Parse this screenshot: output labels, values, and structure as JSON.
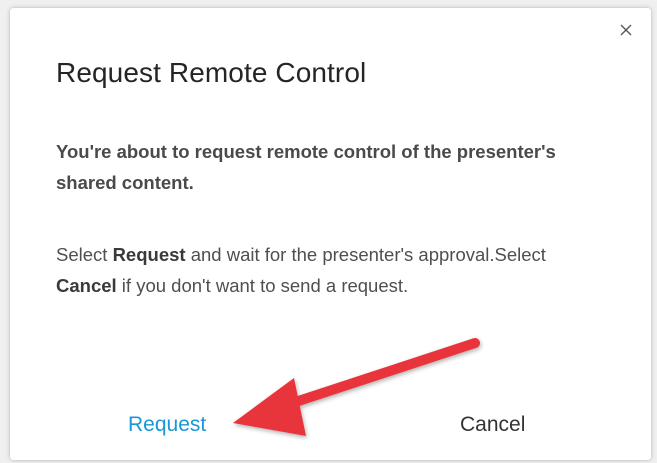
{
  "dialog": {
    "close_glyph": "×",
    "title": "Request Remote Control",
    "lead": "You're about to request remote control of the presenter's shared content.",
    "body": {
      "part1": "Select ",
      "request_word": "Request",
      "part2": " and wait for the presenter's approval.Select ",
      "cancel_word": "Cancel",
      "part3": " if you don't want to send a request."
    },
    "buttons": {
      "request_label": "Request",
      "cancel_label": "Cancel"
    }
  },
  "annotation": {
    "arrow_color": "#e8343a",
    "points_to": "request-button"
  },
  "colors": {
    "accent": "#1a97d6",
    "title": "#252525",
    "text": "#4f4f4f"
  }
}
